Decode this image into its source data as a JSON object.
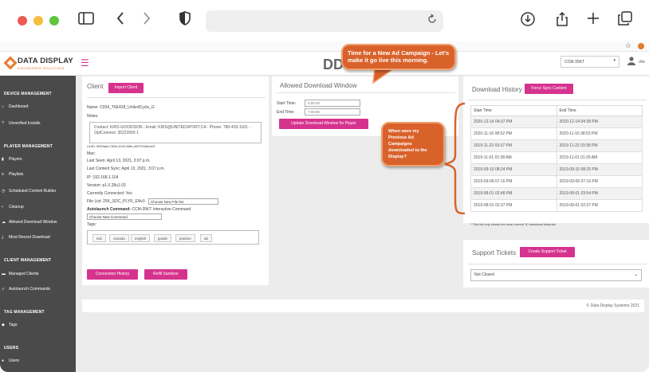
{
  "app": {
    "logo_name": "DATA DISPLAY",
    "logo_tagline": "ENGINEERED SOLUTIONS",
    "header_title": "DD",
    "device_select": "CCM-35KT",
    "user_name": "dds"
  },
  "sidebar": {
    "sections": [
      {
        "title": "DEVICE MANAGEMENT",
        "items": [
          {
            "label": "Dashboard",
            "icon": "home-icon"
          },
          {
            "label": "Unverified Installs",
            "icon": "question-icon"
          }
        ]
      },
      {
        "title": "PLAYER MANAGEMENT",
        "items": [
          {
            "label": "Players",
            "icon": "player-icon"
          },
          {
            "label": "Playlists",
            "icon": "list-icon"
          },
          {
            "label": "Scheduled Content Builder",
            "icon": "clock-icon"
          },
          {
            "label": "Cleanup",
            "icon": "trash-icon"
          },
          {
            "label": "Allowed Download Window",
            "icon": "cloud-icon"
          },
          {
            "label": "Most Recent Download",
            "icon": "download-icon"
          }
        ]
      },
      {
        "title": "CLIENT MANAGEMENT",
        "items": [
          {
            "label": "Managed Clients",
            "icon": "briefcase-icon"
          },
          {
            "label": "Autolaunch Commands",
            "icon": "rocket-icon"
          }
        ]
      },
      {
        "title": "TAG MANAGEMENT",
        "items": [
          {
            "label": "Tags",
            "icon": "tag-icon"
          }
        ]
      },
      {
        "title": "USERS",
        "items": [
          {
            "label": "Users",
            "icon": "user-icon"
          }
        ]
      }
    ]
  },
  "client": {
    "title": "Client",
    "import_button": "Import Client",
    "name": "Name: C034_T6E428_UnitedCycle_G",
    "notes_label": "Notes:",
    "notes_text": "Contact: KRIS GOODISON - Email: KRIS@UNITEDSPORT.CA - Phone: 780-433-1181 - OptConnect: 35222009 1",
    "uuid": "UUID: 9f52fa6a-7856-4e32-88fe-a5375168a4e9",
    "mac_label": "Mac:",
    "last_seen": "Last Seen: April 13, 2021, 3:07 p.m.",
    "last_content_sync": "Last Content Sync: April 13, 2021, 3:07 p.m.",
    "ip": "IP: 192.168.1.104",
    "version": "Version: p1.0.28u1.03",
    "currently_connected": "Currently Connected: Yes",
    "file_list_label": "File List: 25K_SDC_PLYR_ENv3",
    "file_list_select": "Choose New File list",
    "autolaunch_label": "Autolaunch Command:",
    "autolaunch_value": "CCM-35KT Interactive Command",
    "command_select": "Choose New Command",
    "tags_label": "Tags:",
    "tags": [
      "edc",
      "canada",
      "english",
      "goalie",
      "prairies",
      "ab"
    ],
    "connection_history_button": "Connection History",
    "refill_button": "Refill Sanitizer"
  },
  "download_window": {
    "title": "Allowed Download Window",
    "start_label": "Start Time:",
    "start_value": "0:00:00",
    "end_label": "End Time:",
    "end_value": "7:00:00",
    "update_button": "Update Download Window for Player"
  },
  "history": {
    "title": "Download History",
    "force_button": "Force Sync Content",
    "columns": [
      "Start Time",
      "End Time"
    ],
    "rows": [
      [
        "2020-12-14 04:37 PM",
        "2020-12-14 04:38 PM"
      ],
      [
        "2020-11-16 08:52 PM",
        "2020-11-16 08:53 PM"
      ],
      [
        "2019-11-22 03:37 PM",
        "2019-11-22 03:38 PM"
      ],
      [
        "2019-11-01 01:38 AM",
        "2019-11-01 01:39 AM"
      ],
      [
        "2019-09-10 08:24 PM",
        "2019-09-10 08:25 PM"
      ],
      [
        "2019-09-09 07:16 PM",
        "2019-09-09 07:16 PM"
      ],
      [
        "2019-08-01 02:48 PM",
        "2019-08-01 03:54 PM"
      ],
      [
        "2019-08-01 02:37 PM",
        "2019-08-01 02:37 PM"
      ]
    ],
    "note": "* This list only shows the most current 10 download histories."
  },
  "support": {
    "title": "Support Tickets",
    "create_button": "Create Support Ticket",
    "filter_select": "Not Closed"
  },
  "footer": {
    "copyright": "© Data Display Systems 2021"
  },
  "callouts": {
    "top": "Time for a New Ad Campaign - Let's make it go live this morning.",
    "side": "When were my Previous Ad Campaigns downloaded to the Display?"
  },
  "colors": {
    "accent": "#d6338f",
    "sidebar": "#4a4a4a",
    "callout": "#d9622b",
    "brand_orange": "#e8792d"
  }
}
